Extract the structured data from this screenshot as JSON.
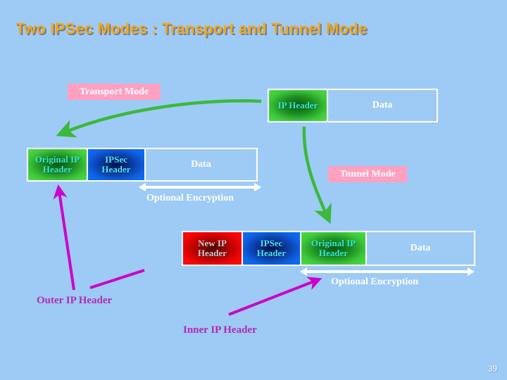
{
  "slide": {
    "title": "Two IPSec Modes : Transport and Tunnel Mode",
    "background_color": "#9ecbf5",
    "title_color": "#f0a823",
    "page_number": "39"
  },
  "labels": {
    "transport_mode": "Transport Mode",
    "tunnel_mode": "Tunnel Mode",
    "mode_label_bg": "#ffa0c0",
    "mode_label_color": "#ffffff"
  },
  "diagram": {
    "transport_result_row": {
      "name": "Transport mode resulting packet",
      "cells": [
        {
          "label": "IP Header",
          "style": "green"
        },
        {
          "label": "Data",
          "style": "plain"
        }
      ]
    },
    "transport_original_row": {
      "name": "Transport mode original packet",
      "cells": [
        {
          "label": "Original IP\nHeader",
          "style": "green"
        },
        {
          "label": "IPSec\nHeader",
          "style": "blue"
        },
        {
          "label": "Data",
          "style": "plain"
        }
      ]
    },
    "tunnel_result_row": {
      "name": "Tunnel mode resulting packet",
      "cells": [
        {
          "label": "New IP\nHeader",
          "style": "red"
        },
        {
          "label": "IPSec\nHeader",
          "style": "blue"
        },
        {
          "label": "Original IP\nHeader",
          "style": "green"
        },
        {
          "label": "Data",
          "style": "plain"
        }
      ]
    }
  },
  "annotations": {
    "optional_encryption_transport": "Optional Encryption",
    "optional_encryption_tunnel": "Optional Encryption",
    "outer_ip_header": "Outer IP Header",
    "inner_ip_header": "Inner IP Header",
    "purple_color": "#b32ab3",
    "arrow_green_color": "#3cb83c",
    "arrow_magenta_color": "#cc00cc"
  }
}
